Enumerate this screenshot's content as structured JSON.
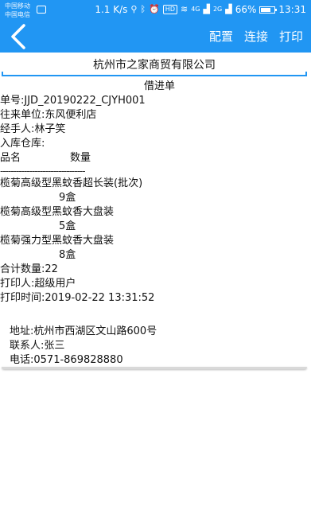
{
  "status_bar": {
    "carrier_1": "中国移动",
    "carrier_2": "中国电信",
    "speed": "1.1 K/s",
    "signal_4g": "4G",
    "signal_2g": "2G",
    "battery": "66%",
    "time": "13:31",
    "hd": "HD"
  },
  "app_bar": {
    "back_icon": "back-arrow",
    "actions": {
      "config": "配置",
      "connect": "连接",
      "print": "打印"
    }
  },
  "company": {
    "value": "杭州市之家商贸有限公司"
  },
  "receipt": {
    "title": "借进单",
    "order_no": "单号:JJD_20190222_CJYH001",
    "partner": "往来单位:东风便利店",
    "handler": "经手人:林子笑",
    "warehouse": "入库仓库:",
    "col_name": "品名",
    "col_qty": "数量",
    "divider": "--------------------------------",
    "items": [
      {
        "name": "榄菊高级型黑蚊香超长装(批次)",
        "qty": "9盒"
      },
      {
        "name": "榄菊高级型黑蚊香大盘装",
        "qty": "5盒"
      },
      {
        "name": "榄菊强力型黑蚊香大盘装",
        "qty": "8盒"
      }
    ],
    "total": "合计数量:22",
    "printer": "打印人:超级用户",
    "print_time": "打印时间:2019-02-22 13:31:52"
  },
  "footer": {
    "address": "地址:杭州市西湖区文山路600号",
    "contact": "联系人:张三",
    "phone": "电话:0571-869828880"
  },
  "colors": {
    "primary": "#2196f3",
    "text": "#111111",
    "background": "#ffffff"
  }
}
